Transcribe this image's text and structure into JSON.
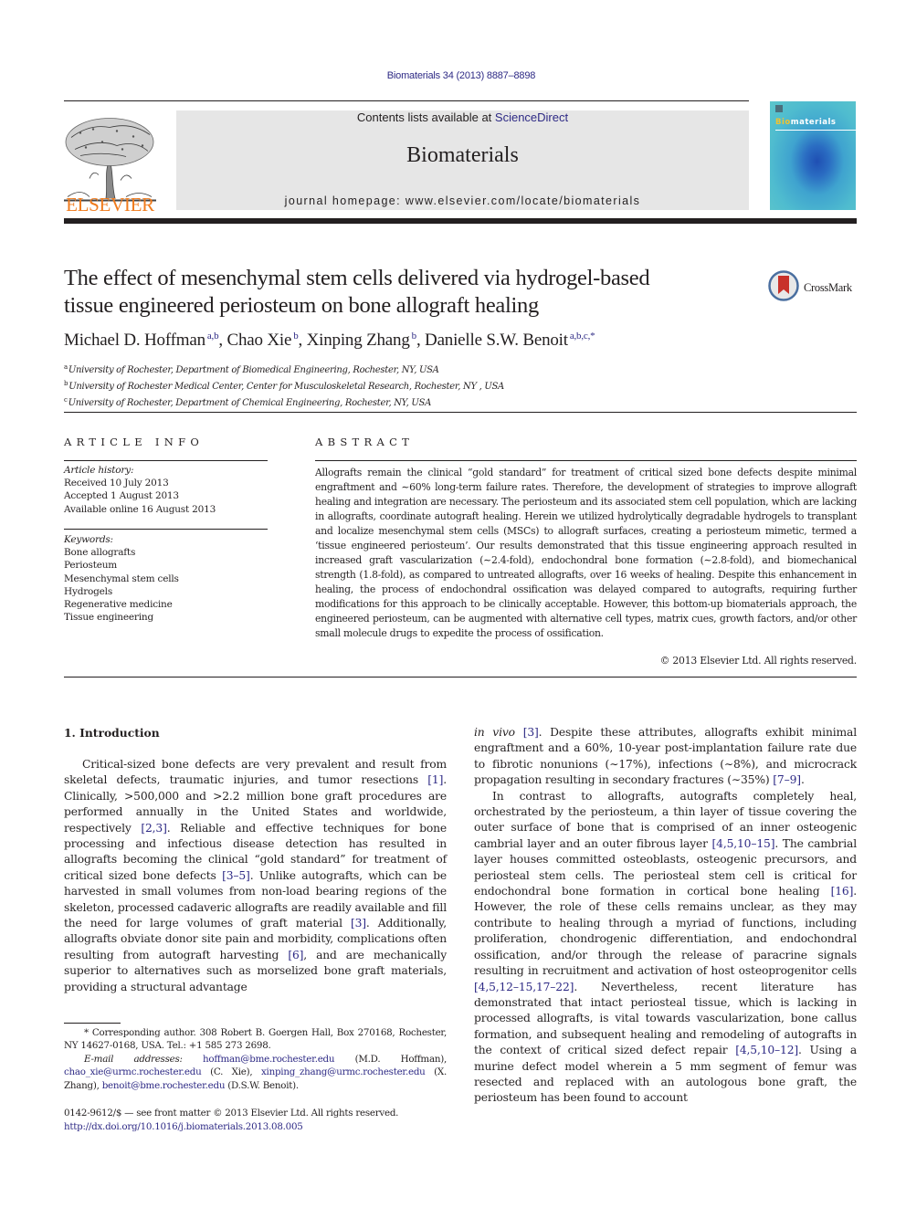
{
  "header": {
    "citation": "Biomaterials 34 (2013) 8887–8898",
    "contents_prefix": "Contents lists available at ",
    "contents_link": "ScienceDirect",
    "journal_name": "Biomaterials",
    "homepage": "journal homepage: www.elsevier.com/locate/biomaterials",
    "publisher_logo_text": "ELSEVIER",
    "cover": {
      "title_highlight": "Bio",
      "title_rest": "materials"
    }
  },
  "colors": {
    "link": "#2e2a85",
    "elsevier_orange": "#f07b1d",
    "masthead_bg": "#e6e6e6",
    "crossmark_red": "#c8312a"
  },
  "article": {
    "title_line1": "The effect of mesenchymal stem cells delivered via hydrogel-based",
    "title_line2": "tissue engineered periosteum on bone allograft healing",
    "crossmark_label": "CrossMark",
    "authors": [
      {
        "name": "Michael D. Hoffman",
        "affil": "a,b"
      },
      {
        "name": "Chao Xie",
        "affil": "b"
      },
      {
        "name": "Xinping Zhang",
        "affil": "b"
      },
      {
        "name": "Danielle S.W. Benoit",
        "affil": "a,b,c,*"
      }
    ],
    "affiliations": [
      {
        "key": "a",
        "text": "University of Rochester, Department of Biomedical Engineering, Rochester, NY, USA"
      },
      {
        "key": "b",
        "text": "University of Rochester Medical Center, Center for Musculoskeletal Research, Rochester, NY , USA"
      },
      {
        "key": "c",
        "text": "University of Rochester, Department of Chemical Engineering, Rochester, NY, USA"
      }
    ]
  },
  "article_info": {
    "label": "ARTICLE INFO",
    "history_label": "Article history:",
    "history": [
      "Received 10 July 2013",
      "Accepted 1 August 2013",
      "Available online 16 August 2013"
    ],
    "keywords_label": "Keywords:",
    "keywords": [
      "Bone allografts",
      "Periosteum",
      "Mesenchymal stem cells",
      "Hydrogels",
      "Regenerative medicine",
      "Tissue engineering"
    ]
  },
  "abstract": {
    "label": "ABSTRACT",
    "text": "Allografts remain the clinical “gold standard” for treatment of critical sized bone defects despite minimal engraftment and ∼60% long-term failure rates. Therefore, the development of strategies to improve allograft healing and integration are necessary. The periosteum and its associated stem cell population, which are lacking in allografts, coordinate autograft healing. Herein we utilized hydrolytically degradable hydrogels to transplant and localize mesenchymal stem cells (MSCs) to allograft surfaces, creating a periosteum mimetic, termed a ‘tissue engineered periosteum’. Our results demonstrated that this tissue engineering approach resulted in increased graft vascularization (∼2.4-fold), endochondral bone for­mation (∼2.8-fold), and biomechanical strength (1.8-fold), as compared to untreated allografts, over 16 weeks of healing. Despite this enhancement in healing, the process of endochondral ossification was delayed compared to autografts, requiring further modifications for this approach to be clinically acceptable. However, this bottom-up biomaterials approach, the engineered periosteum, can be augmented with alternative cell types, matrix cues, growth factors, and/or other small molecule drugs to expedite the process of ossification.",
    "copyright": "© 2013 Elsevier Ltd. All rights reserved."
  },
  "introduction": {
    "heading": "1.  Introduction",
    "left_paragraph": [
      {
        "t": "Critical-sized bone defects are very prevalent and result from skeletal defects, traumatic injuries, and tumor resections "
      },
      {
        "ref": "[1]"
      },
      {
        "t": ". Clinically, >500,000 and >2.2 million bone graft procedures are performed annually in the United States and worldwide, respectively "
      },
      {
        "ref": "[2,3]"
      },
      {
        "t": ". Reliable and effective techniques for bone processing and infectious disease detection has resulted in allografts becoming the clinical “gold standard” for treatment of critical sized bone defects "
      },
      {
        "ref": "[3–5]"
      },
      {
        "t": ". Unlike autografts, which can be harvested in small volumes from non-load bearing regions of the skeleton, processed cadaveric allografts are readily available and fill the need for large volumes of graft material "
      },
      {
        "ref": "[3]"
      },
      {
        "t": ". Additionally, allografts obviate donor site pain and morbidity, complications often resulting from autograft harvesting "
      },
      {
        "ref": "[6]"
      },
      {
        "t": ", and are mechanically superior to alternatives such as morselized bone graft materials, providing a structural advantage"
      }
    ],
    "right_paragraph_1": [
      {
        "i": "in vivo"
      },
      {
        "t": " "
      },
      {
        "ref": "[3]"
      },
      {
        "t": ". Despite these attributes, allografts exhibit minimal engraftment and a 60%, 10-year post-implantation failure rate due to fibrotic nonunions (∼17%), infections (∼8%), and microcrack propagation resulting in secondary fractures (∼35%) "
      },
      {
        "ref": "[7–9]"
      },
      {
        "t": "."
      }
    ],
    "right_paragraph_2": [
      {
        "t": "In contrast to allografts, autografts completely heal, orchestrated by the periosteum, a thin layer of tissue covering the outer surface of bone that is comprised of an inner osteogenic cambrial layer and an outer fibrous layer "
      },
      {
        "ref": "[4,5,10–15]"
      },
      {
        "t": ". The cambrial layer houses committed osteoblasts, osteogenic precursors, and periosteal stem cells. The periosteal stem cell is critical for endochondral bone formation in cortical bone healing "
      },
      {
        "ref": "[16]"
      },
      {
        "t": ". However, the role of these cells remains unclear, as they may contribute to healing through a myriad of functions, including proliferation, chondrogenic differentiation, and endochondral ossification, and/or through the release of paracrine signals resulting in recruitment and activation of host osteoprogenitor cells "
      },
      {
        "ref": "[4,5,12–15,17–22]"
      },
      {
        "t": ". Nevertheless, recent literature has demonstrated that intact periosteal tissue, which is lacking in processed allografts, is vital towards vascularization, bone callus formation, and subsequent healing and remodeling of autografts in the context of critical sized defect repair "
      },
      {
        "ref": "[4,5,10–12]"
      },
      {
        "t": ". Using a murine defect model wherein a 5 mm segment of femur was resected and replaced with an autologous bone graft, the periosteum has been found to account"
      }
    ]
  },
  "footnotes": {
    "corresponding": "* Corresponding author. 308 Robert B. Goergen Hall, Box 270168, Rochester, NY 14627-0168, USA. Tel.: +1 585 273 2698.",
    "email_label": "E-mail addresses:",
    "emails": [
      {
        "address": "hoffman@bme.rochester.edu",
        "who": "(M.D. Hoffman)"
      },
      {
        "address": "chao_xie@urmc.rochester.edu",
        "who": "(C. Xie)"
      },
      {
        "address": "xinping_zhang@urmc.rochester.edu",
        "who": "(X. Zhang)"
      },
      {
        "address": "benoit@bme.rochester.edu",
        "who": "(D.S.W. Benoit)"
      }
    ],
    "issn_line": "0142-9612/$ — see front matter © 2013 Elsevier Ltd. All rights reserved.",
    "doi": "http://dx.doi.org/10.1016/j.biomaterials.2013.08.005"
  }
}
